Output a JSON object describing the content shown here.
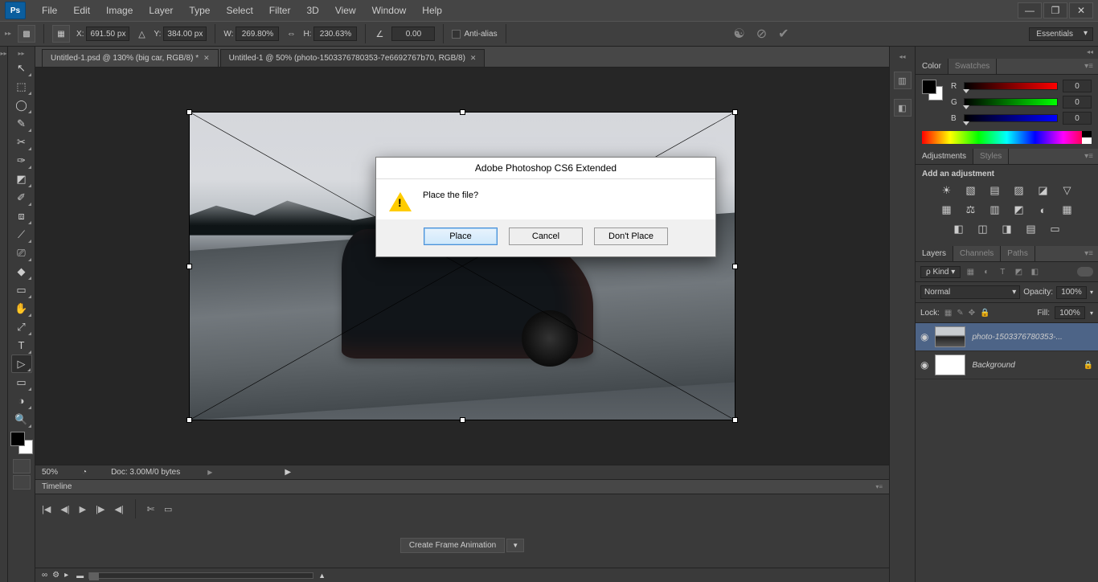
{
  "menubar": {
    "items": [
      "File",
      "Edit",
      "Image",
      "Layer",
      "Type",
      "Select",
      "Filter",
      "3D",
      "View",
      "Window",
      "Help"
    ]
  },
  "window_buttons": {
    "min": "—",
    "restore": "❐",
    "close": "✕"
  },
  "options_bar": {
    "x_label": "X:",
    "x_value": "691.50 px",
    "y_label": "Y:",
    "y_value": "384.00 px",
    "w_label": "W:",
    "w_value": "269.80%",
    "h_label": "H:",
    "h_value": "230.63%",
    "angle_value": "0.00",
    "antialias": "Anti-alias",
    "commit_cancel_icon": "⊘",
    "commit_ok_icon": "✔",
    "softproof_icon": "☯"
  },
  "workspace_selector": "Essentials",
  "tabs": {
    "items": [
      {
        "label": "Untitled-1.psd @ 130% (big car, RGB/8) *",
        "active": false
      },
      {
        "label": "Untitled-1 @ 50% (photo-1503376780353-7e6692767b70, RGB/8)",
        "active": true
      }
    ]
  },
  "tools": {
    "items": [
      "↖",
      "⬚",
      "◯",
      "✎",
      "✂",
      "✑",
      "◩",
      "✐",
      "⧈",
      "⟋",
      "⎚",
      "◆",
      "▭",
      "✋",
      "⤢",
      "T",
      "▷",
      "▭",
      "◑",
      "🔍"
    ]
  },
  "status": {
    "zoom": "50%",
    "doc": "Doc: 3.00M/0 bytes",
    "play_arrow": "▶"
  },
  "timeline": {
    "tab": "Timeline",
    "controls": [
      "|◀",
      "◀|",
      "▶",
      "|▶",
      "◀|"
    ],
    "scissors": "✄",
    "split": "▭",
    "create_btn": "Create Frame Animation",
    "footer_icons": [
      "∞",
      "⚙",
      "▸"
    ]
  },
  "color_panel": {
    "tabs": [
      "Color",
      "Swatches"
    ],
    "r_label": "R",
    "g_label": "G",
    "b_label": "B",
    "r_val": "0",
    "g_val": "0",
    "b_val": "0"
  },
  "adjustments_panel": {
    "tabs": [
      "Adjustments",
      "Styles"
    ],
    "header": "Add an adjustment",
    "row1": [
      "☀",
      "▧",
      "▤",
      "▨",
      "◪",
      "▽"
    ],
    "row2": [
      "▦",
      "⚖",
      "▥",
      "◩",
      "◐",
      "▦"
    ],
    "row3": [
      "◧",
      "◫",
      "◨",
      "▤",
      "▭"
    ]
  },
  "layers_panel": {
    "tabs": [
      "Layers",
      "Channels",
      "Paths"
    ],
    "kind": "ρ Kind",
    "filters": [
      "▦",
      "◐",
      "T",
      "◩",
      "◧"
    ],
    "blend_mode": "Normal",
    "opacity_label": "Opacity:",
    "opacity_value": "100%",
    "lock_label": "Lock:",
    "lock_icons": [
      "▦",
      "✎",
      "✥",
      "🔒"
    ],
    "fill_label": "Fill:",
    "fill_value": "100%",
    "layers": [
      {
        "name": "photo-1503376780353-...",
        "thumb": "car",
        "italic": true,
        "selected": true,
        "locked": false
      },
      {
        "name": "Background",
        "thumb": "white",
        "italic": true,
        "selected": false,
        "locked": true
      }
    ]
  },
  "dialog": {
    "title": "Adobe Photoshop CS6 Extended",
    "message": "Place the file?",
    "buttons": {
      "place": "Place",
      "cancel": "Cancel",
      "dont_place": "Don't Place"
    }
  }
}
